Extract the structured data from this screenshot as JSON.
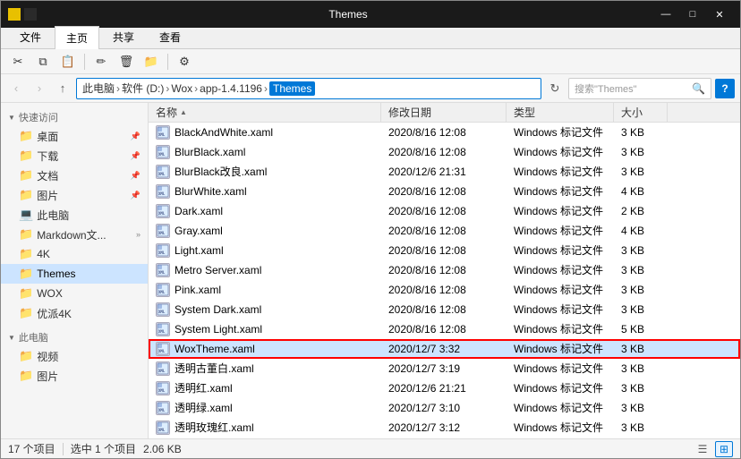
{
  "window": {
    "title": "Themes",
    "icons": [
      "yellow-square",
      "dark-square"
    ]
  },
  "ribbon": {
    "tabs": [
      "文件",
      "主页",
      "共享",
      "查看"
    ],
    "active_tab": "主页"
  },
  "toolbar": {
    "back": "‹",
    "forward": "›",
    "up": "↑",
    "path": {
      "parts": [
        "此电脑",
        "软件 (D:)",
        "Wox",
        "app-1.4.1196",
        "Themes"
      ]
    },
    "search_placeholder": "搜索\"Themes\"",
    "help_label": "?"
  },
  "sidebar": {
    "sections": [
      {
        "label": "快速访问",
        "items": [
          {
            "name": "桌面",
            "icon": "📁",
            "pinned": true
          },
          {
            "name": "下载",
            "icon": "📁",
            "pinned": true
          },
          {
            "name": "文档",
            "icon": "📁",
            "pinned": true
          },
          {
            "name": "图片",
            "icon": "📁",
            "pinned": true
          },
          {
            "name": "此电脑",
            "icon": "💻"
          },
          {
            "name": "Markdown文...",
            "icon": "📁",
            "expand": true
          },
          {
            "name": "4K",
            "icon": "📁"
          },
          {
            "name": "Themes",
            "icon": "📁",
            "active": true
          },
          {
            "name": "WOX",
            "icon": "📁"
          },
          {
            "name": "优派4K",
            "icon": "📁"
          }
        ]
      },
      {
        "label": "此电脑",
        "items": [
          {
            "name": "视频",
            "icon": "📁"
          },
          {
            "name": "图片",
            "icon": "📁"
          }
        ]
      }
    ]
  },
  "columns": {
    "name": {
      "label": "名称",
      "sort": "asc"
    },
    "date": {
      "label": "修改日期"
    },
    "type": {
      "label": "类型"
    },
    "size": {
      "label": "大小"
    }
  },
  "files": [
    {
      "name": "BlackAndWhite.xaml",
      "date": "2020/8/16 12:08",
      "type": "Windows 标记文件",
      "size": "3 KB"
    },
    {
      "name": "BlurBlack.xaml",
      "date": "2020/8/16 12:08",
      "type": "Windows 标记文件",
      "size": "3 KB"
    },
    {
      "name": "BlurBlack改良.xaml",
      "date": "2020/12/6 21:31",
      "type": "Windows 标记文件",
      "size": "3 KB"
    },
    {
      "name": "BlurWhite.xaml",
      "date": "2020/8/16 12:08",
      "type": "Windows 标记文件",
      "size": "4 KB"
    },
    {
      "name": "Dark.xaml",
      "date": "2020/8/16 12:08",
      "type": "Windows 标记文件",
      "size": "2 KB"
    },
    {
      "name": "Gray.xaml",
      "date": "2020/8/16 12:08",
      "type": "Windows 标记文件",
      "size": "4 KB"
    },
    {
      "name": "Light.xaml",
      "date": "2020/8/16 12:08",
      "type": "Windows 标记文件",
      "size": "3 KB"
    },
    {
      "name": "Metro Server.xaml",
      "date": "2020/8/16 12:08",
      "type": "Windows 标记文件",
      "size": "3 KB"
    },
    {
      "name": "Pink.xaml",
      "date": "2020/8/16 12:08",
      "type": "Windows 标记文件",
      "size": "3 KB"
    },
    {
      "name": "System Dark.xaml",
      "date": "2020/8/16 12:08",
      "type": "Windows 标记文件",
      "size": "3 KB"
    },
    {
      "name": "System Light.xaml",
      "date": "2020/8/16 12:08",
      "type": "Windows 标记文件",
      "size": "5 KB"
    },
    {
      "name": "WoxTheme.xaml",
      "date": "2020/12/7 3:32",
      "type": "Windows 标记文件",
      "size": "3 KB",
      "selected": true,
      "highlighted": true
    },
    {
      "name": "透明古董白.xaml",
      "date": "2020/12/7 3:19",
      "type": "Windows 标记文件",
      "size": "3 KB"
    },
    {
      "name": "透明红.xaml",
      "date": "2020/12/6 21:21",
      "type": "Windows 标记文件",
      "size": "3 KB"
    },
    {
      "name": "透明绿.xaml",
      "date": "2020/12/7 3:10",
      "type": "Windows 标记文件",
      "size": "3 KB"
    },
    {
      "name": "透明玫瑰红.xaml",
      "date": "2020/12/7 3:12",
      "type": "Windows 标记文件",
      "size": "3 KB"
    }
  ],
  "status": {
    "total": "17 个项目",
    "selected": "选中 1 个项目",
    "size": "2.06 KB"
  },
  "colors": {
    "accent": "#0078d7",
    "title_bar": "#1a1a1a",
    "selected_bg": "#cce4ff",
    "hover_bg": "#e5f3ff",
    "highlight_border": "#ff0000"
  }
}
